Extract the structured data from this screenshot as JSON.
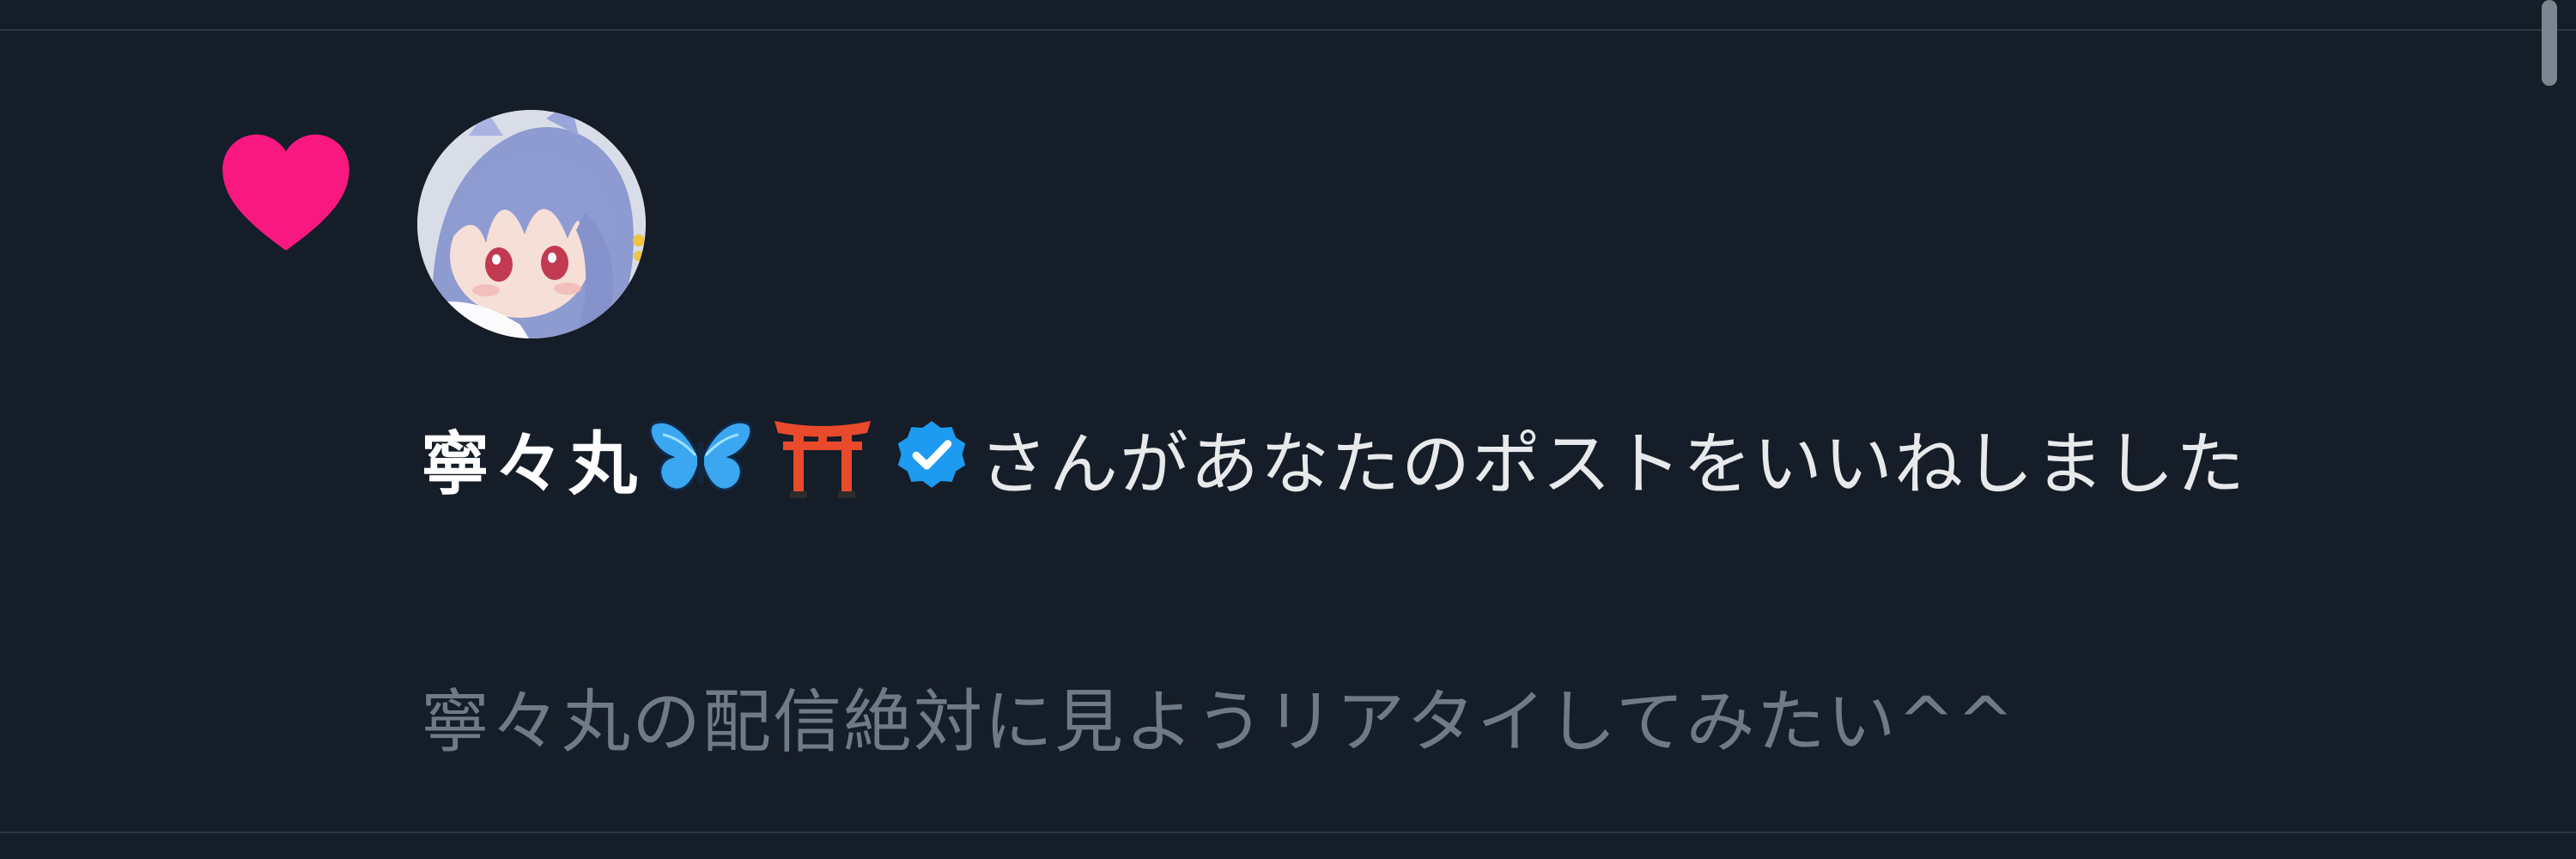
{
  "notification": {
    "display_name": "寧々丸",
    "action_text": "さんがあなたのポストをいいねしました",
    "post_excerpt": "寧々丸の配信絶対に見ようリアタイしてみたい^^"
  },
  "icons": {
    "reaction": "heart-icon",
    "name_emojis": [
      "butterfly-icon",
      "torii-gate-icon"
    ],
    "badge": "verified-badge-icon"
  },
  "colors": {
    "background": "#151d28",
    "heart": "#f91880",
    "verified": "#1d9bf0",
    "primary_text": "#e7e9ea",
    "secondary_text": "#6e7b86",
    "divider": "#2b3641"
  }
}
